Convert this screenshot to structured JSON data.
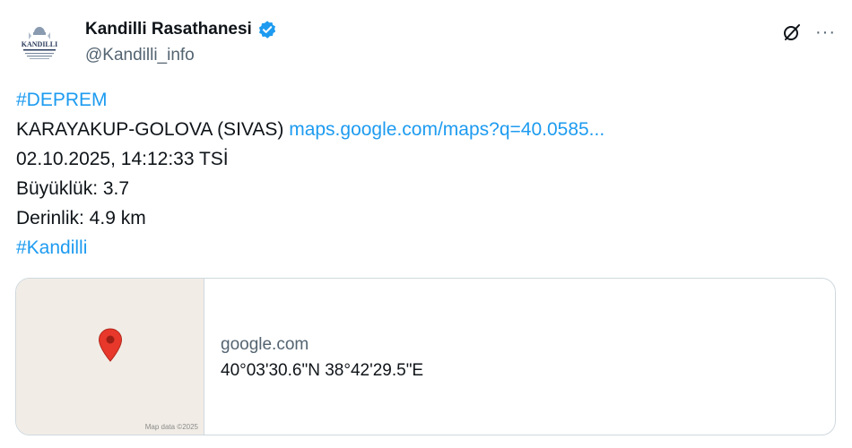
{
  "author": {
    "display_name": "Kandilli Rasathanesi",
    "handle": "@Kandilli_info",
    "avatar_text": "KANDILLI",
    "verified_icon": "verified-badge-icon"
  },
  "actions": {
    "grok_icon": "grok-icon",
    "more_label": "···"
  },
  "tweet": {
    "hashtag_top": "#DEPREM",
    "location": "KARAYAKUP-GOLOVA (SIVAS)",
    "link": "maps.google.com/maps?q=40.0585...",
    "datetime": "02.10.2025, 14:12:33 TSİ",
    "magnitude": "Büyüklük: 3.7",
    "depth": "Derinlik: 4.9 km",
    "hashtag_bottom": "#Kandilli"
  },
  "card": {
    "map_credit": "Map data ©2025",
    "domain": "google.com",
    "title": "40°03'30.6\"N 38°42'29.5\"E"
  },
  "colors": {
    "link": "#1d9bf0",
    "verified": "#1d9bf0",
    "pin": "#e8382b",
    "map_bg": "#f1ede6"
  }
}
